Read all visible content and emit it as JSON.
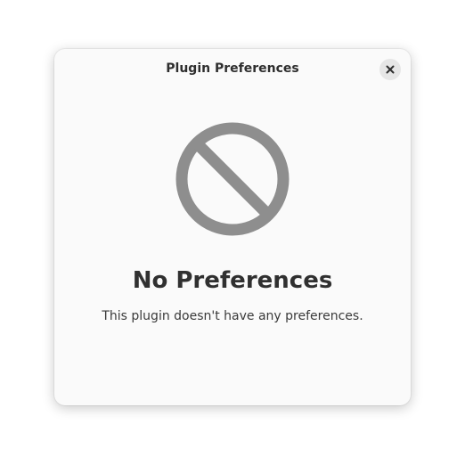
{
  "dialog": {
    "title": "Plugin Preferences",
    "close_icon": "close-icon"
  },
  "status_page": {
    "icon": "no-entry-icon",
    "title": "No Preferences",
    "description": "This plugin doesn't have any preferences."
  },
  "colors": {
    "dialog_bg": "#fafafa",
    "icon_gray": "#8e8e8e",
    "text_dark": "#303030"
  }
}
